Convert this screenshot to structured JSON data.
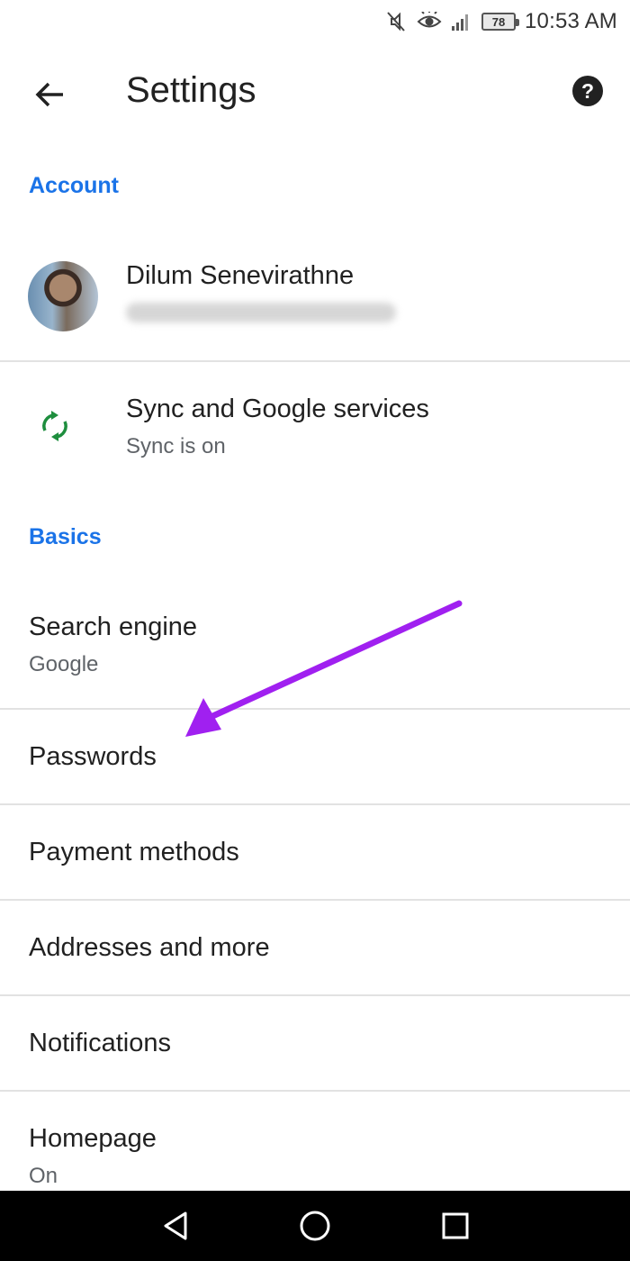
{
  "status_bar": {
    "time": "10:53 AM",
    "battery": "78",
    "icons": [
      "mute-icon",
      "eye-icon",
      "signal-icon",
      "battery-icon"
    ]
  },
  "app_bar": {
    "title": "Settings",
    "back_icon": "arrow-left-icon",
    "help_icon": "help-icon",
    "help_glyph": "?"
  },
  "sections": {
    "account": "Account",
    "basics": "Basics"
  },
  "account": {
    "name": "Dilum Senevirathne"
  },
  "sync": {
    "title": "Sync and Google services",
    "subtitle": "Sync is on"
  },
  "settings": {
    "search_engine": {
      "title": "Search engine",
      "subtitle": "Google"
    },
    "passwords": {
      "title": "Passwords"
    },
    "payment_methods": {
      "title": "Payment methods"
    },
    "addresses": {
      "title": "Addresses and more"
    },
    "notifications": {
      "title": "Notifications"
    },
    "homepage": {
      "title": "Homepage",
      "subtitle": "On"
    }
  },
  "nav_bar": {
    "icons": [
      "back-triangle-icon",
      "home-circle-icon",
      "recents-square-icon"
    ]
  },
  "colors": {
    "accent_blue": "#1a73e8",
    "sync_green": "#1e8e3e",
    "annotation_purple": "#a020f0",
    "nav_background": "#000000"
  }
}
